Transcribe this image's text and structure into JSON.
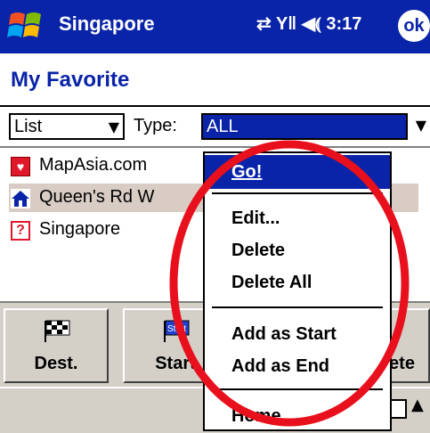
{
  "titlebar": {
    "app_title": "Singapore",
    "status_icons": "⇄ Y‖ ◀⦅ 3:17",
    "ok_label": "ok"
  },
  "page": {
    "title": "My Favorite"
  },
  "filter": {
    "view_value": "List",
    "type_label": "Type:",
    "type_value": "ALL"
  },
  "list": {
    "items": [
      {
        "label": "MapAsia.com",
        "icon": "heart-icon",
        "selected": false
      },
      {
        "label": "Queen's Rd W",
        "icon": "house-icon",
        "selected": true
      },
      {
        "label": "Singapore",
        "icon": "question-icon",
        "selected": false
      }
    ]
  },
  "buttons": [
    {
      "label": "Dest.",
      "icon": "checkered-flag-icon"
    },
    {
      "label": "Start",
      "icon": "start-flag-icon",
      "icon_text": "Start"
    },
    {
      "label": "ete",
      "icon": "delete-icon"
    }
  ],
  "context_menu": {
    "items": [
      {
        "label": "Go!",
        "highlighted": true
      },
      {
        "label": "Edit..."
      },
      {
        "label": "Delete"
      },
      {
        "label": "Delete All"
      },
      {
        "label": "Add as Start"
      },
      {
        "label": "Add as End"
      },
      {
        "label": "Home"
      }
    ]
  },
  "colors": {
    "titlebar": "#0a24a9",
    "highlight": "#0a24a9",
    "annotation": "#e8101c"
  }
}
